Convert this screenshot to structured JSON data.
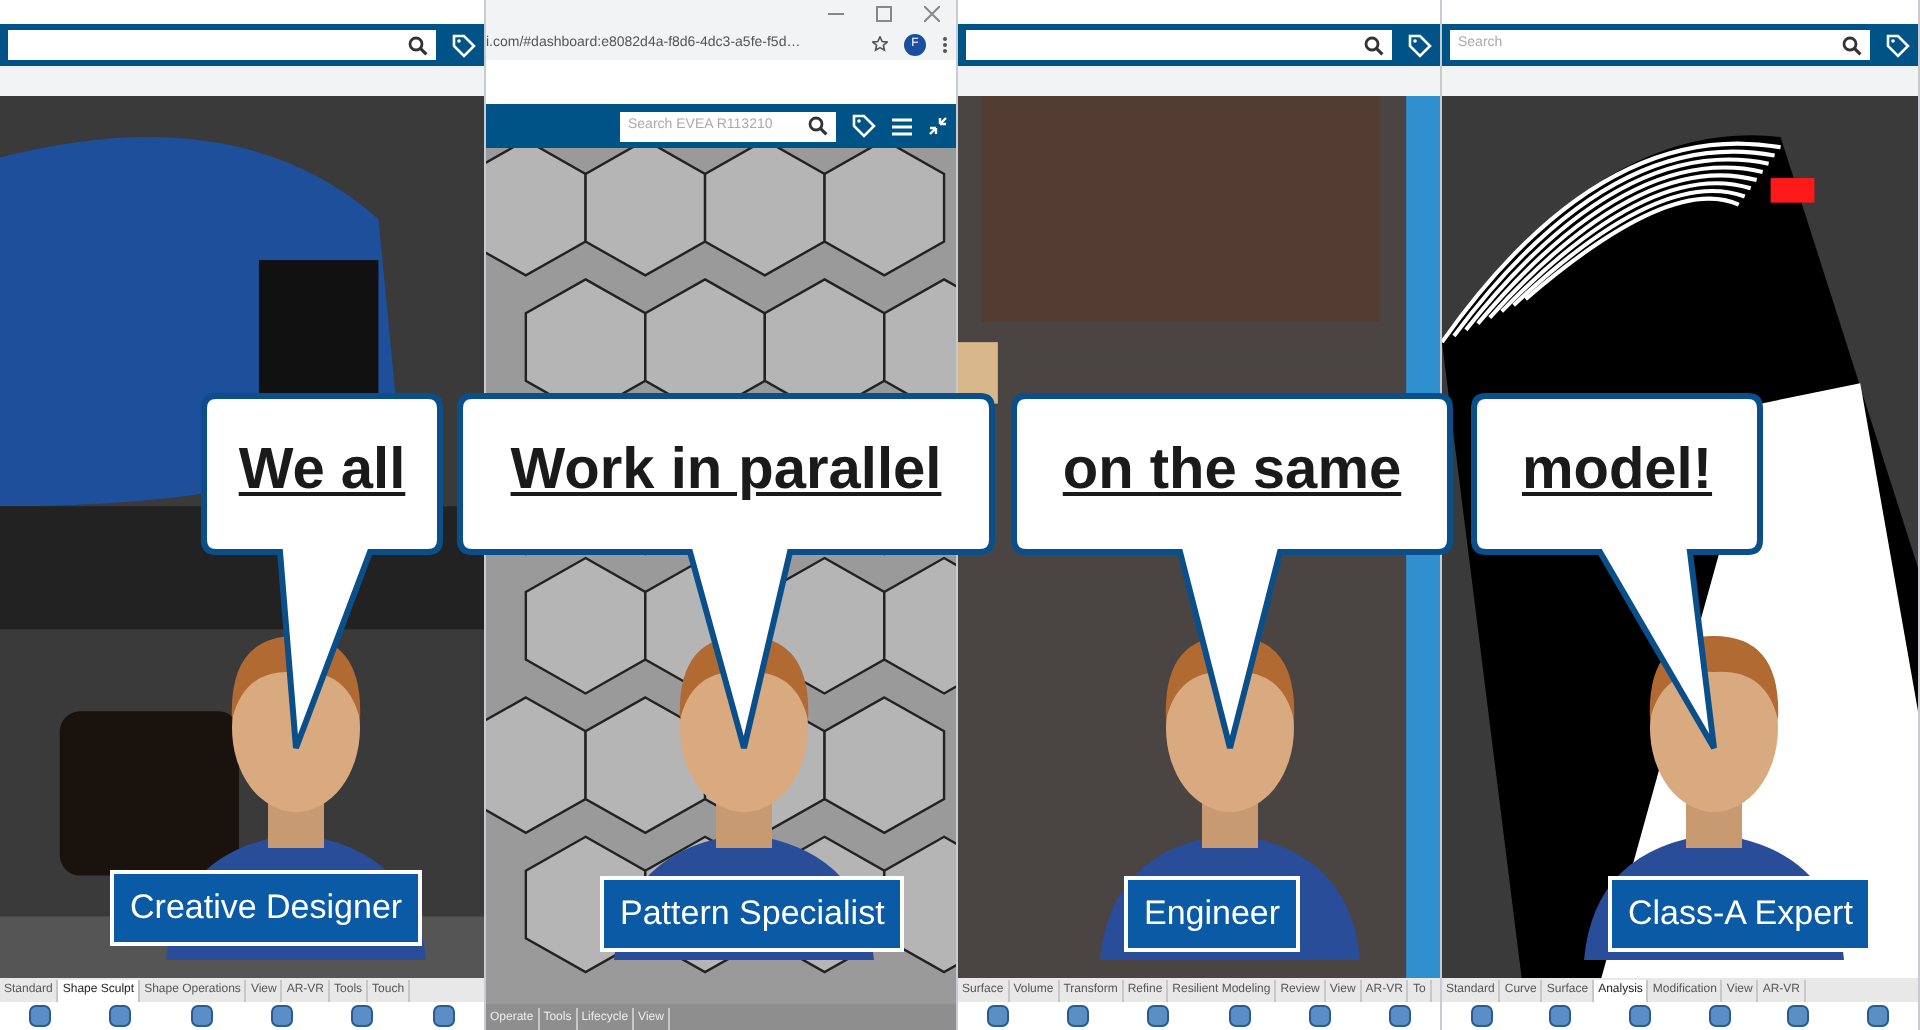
{
  "panels": [
    {
      "kind": "app",
      "toolbar_tabs": [
        {
          "label": "Standard",
          "selected": false
        },
        {
          "label": "Shape Sculpt",
          "selected": true
        },
        {
          "label": "Shape Operations",
          "selected": false
        },
        {
          "label": "View",
          "selected": false
        },
        {
          "label": "AR-VR",
          "selected": false
        },
        {
          "label": "Tools",
          "selected": false
        },
        {
          "label": "Touch",
          "selected": false
        }
      ],
      "bubble": "We all",
      "caption": "Creative Designer"
    },
    {
      "kind": "browser",
      "url": "i.com/#dashboard:e8082d4a-f8d6-4dc3-a5fe-f5d…",
      "profile": "F",
      "search": {
        "placeholder": "Search EVEA R113210"
      },
      "toolbar_tabs": [
        {
          "label": "Operate",
          "selected": false
        },
        {
          "label": "Tools",
          "selected": false
        },
        {
          "label": "Lifecycle",
          "selected": false
        },
        {
          "label": "View",
          "selected": false
        }
      ],
      "bubble": "Work in parallel",
      "caption": "Pattern Specialist"
    },
    {
      "kind": "app",
      "toolbar_tabs": [
        {
          "label": "Surface",
          "selected": false
        },
        {
          "label": "Volume",
          "selected": false
        },
        {
          "label": "Transform",
          "selected": false
        },
        {
          "label": "Refine",
          "selected": false
        },
        {
          "label": "Resilient Modeling",
          "selected": false
        },
        {
          "label": "Review",
          "selected": false
        },
        {
          "label": "View",
          "selected": false
        },
        {
          "label": "AR-VR",
          "selected": false
        },
        {
          "label": "To",
          "selected": false
        }
      ],
      "bubble": "on the same",
      "caption": "Engineer"
    },
    {
      "kind": "app",
      "search": {
        "placeholder": "Search"
      },
      "toolbar_tabs": [
        {
          "label": "Standard",
          "selected": false
        },
        {
          "label": "Curve",
          "selected": false
        },
        {
          "label": "Surface",
          "selected": false
        },
        {
          "label": "Analysis",
          "selected": true
        },
        {
          "label": "Modification",
          "selected": false
        },
        {
          "label": "View",
          "selected": false
        },
        {
          "label": "AR-VR",
          "selected": false
        }
      ],
      "bubble": "model!",
      "caption": "Class-A Expert"
    }
  ]
}
